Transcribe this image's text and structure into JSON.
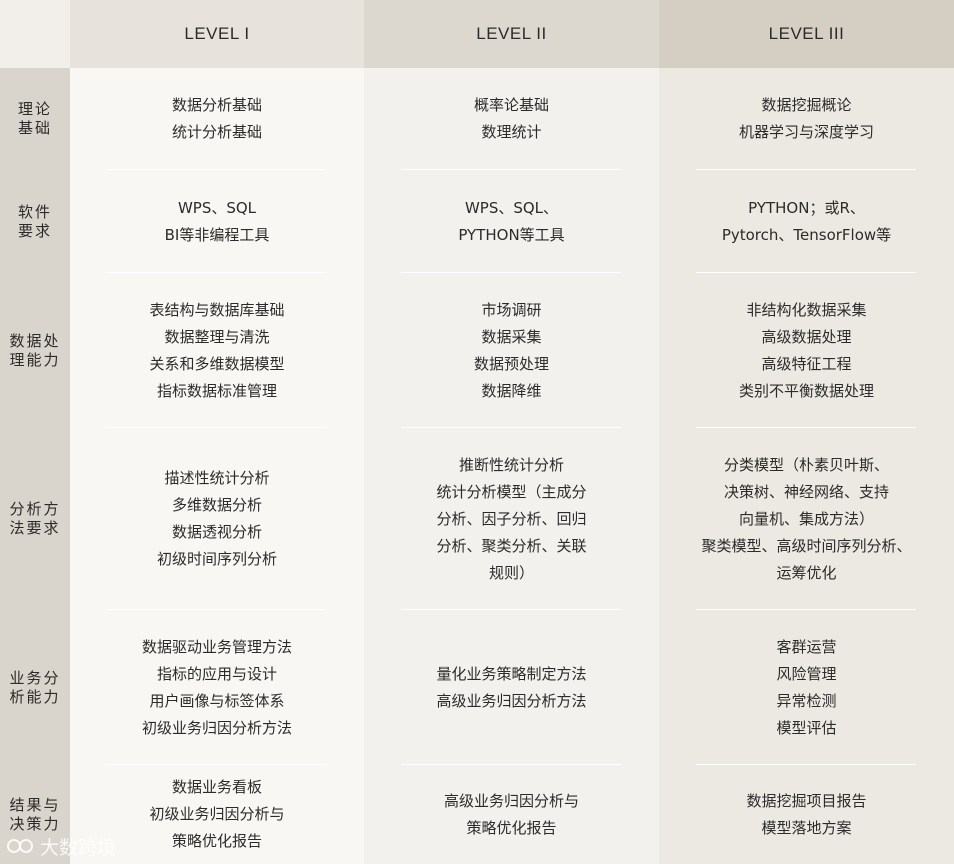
{
  "header": {
    "levels": [
      "LEVEL I",
      "LEVEL II",
      "LEVEL III"
    ]
  },
  "rows": [
    {
      "label": [
        "理论",
        "基础"
      ],
      "cells": [
        [
          "数据分析基础",
          "统计分析基础"
        ],
        [
          "概率论基础",
          "数理统计"
        ],
        [
          "数据挖掘概论",
          "机器学习与深度学习"
        ]
      ]
    },
    {
      "label": [
        "软件",
        "要求"
      ],
      "cells": [
        [
          "WPS、SQL",
          "BI等非编程工具"
        ],
        [
          "WPS、SQL、",
          "PYTHON等工具"
        ],
        [
          "PYTHON；或R、",
          "Pytorch、TensorFlow等"
        ]
      ]
    },
    {
      "label": [
        "数据处",
        "理能力"
      ],
      "cells": [
        [
          "表结构与数据库基础",
          "数据整理与清洗",
          "关系和多维数据模型",
          "指标数据标准管理"
        ],
        [
          "市场调研",
          "数据采集",
          "数据预处理",
          "数据降维"
        ],
        [
          "非结构化数据采集",
          "高级数据处理",
          "高级特征工程",
          "类别不平衡数据处理"
        ]
      ]
    },
    {
      "label": [
        "分析方",
        "法要求"
      ],
      "cells": [
        [
          "描述性统计分析",
          "多维数据分析",
          "数据透视分析",
          "初级时间序列分析"
        ],
        [
          "推断性统计分析",
          "统计分析模型（主成分",
          "分析、因子分析、回归",
          "分析、聚类分析、关联",
          "规则）"
        ],
        [
          "分类模型（朴素贝叶斯、",
          "决策树、神经网络、支持",
          "向量机、集成方法）",
          "聚类模型、高级时间序列分析、",
          "运筹优化"
        ]
      ]
    },
    {
      "label": [
        "业务分",
        "析能力"
      ],
      "cells": [
        [
          "数据驱动业务管理方法",
          "指标的应用与设计",
          "用户画像与标签体系",
          "初级业务归因分析方法"
        ],
        [
          "量化业务策略制定方法",
          "高级业务归因分析方法"
        ],
        [
          "客群运营",
          "风险管理",
          "异常检测",
          "模型评估"
        ]
      ]
    },
    {
      "label": [
        "结果与",
        "决策力"
      ],
      "cells": [
        [
          "数据业务看板",
          "初级业务归因分析与",
          "策略优化报告"
        ],
        [
          "高级业务归因分析与",
          "策略优化报告"
        ],
        [
          "数据挖掘项目报告",
          "模型落地方案"
        ]
      ]
    }
  ],
  "watermark": {
    "text": "大数跨境",
    "icon": "logo-icon"
  },
  "colors": {
    "header1": "#e7e3dc",
    "header2": "#ddd8cf",
    "header3": "#d4cec3",
    "sidebar": "#d9d4cc",
    "col1": "#f8f7f4",
    "col2": "#f3f1ed",
    "col3": "#ece9e3"
  }
}
